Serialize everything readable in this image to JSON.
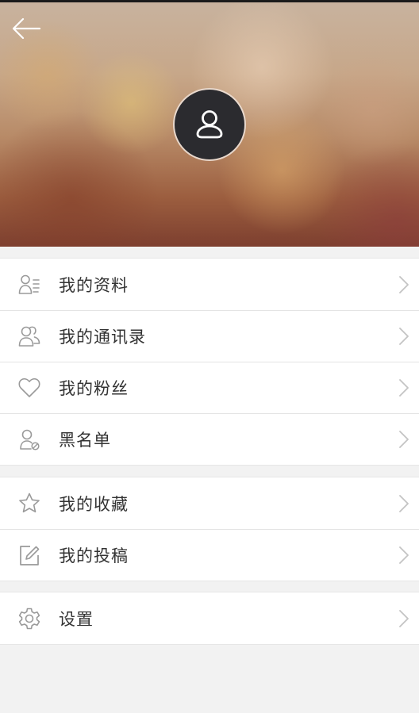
{
  "colors": {
    "page_background": "#f2f2f2",
    "row_background": "#ffffff",
    "text": "#333333",
    "icon_stroke": "#9a9a9a",
    "avatar_background": "#2b2b2f"
  },
  "header": {
    "back_icon": "arrow-left-icon",
    "avatar_icon": "user-icon"
  },
  "menu": {
    "group1": [
      {
        "label": "我的资料",
        "icon": "profile-card-icon"
      },
      {
        "label": "我的通讯录",
        "icon": "contacts-icon"
      },
      {
        "label": "我的粉丝",
        "icon": "heart-icon"
      },
      {
        "label": "黑名单",
        "icon": "blocked-user-icon"
      }
    ],
    "group2": [
      {
        "label": "我的收藏",
        "icon": "star-icon"
      },
      {
        "label": "我的投稿",
        "icon": "edit-icon"
      }
    ],
    "group3": [
      {
        "label": "设置",
        "icon": "gear-icon"
      }
    ]
  }
}
